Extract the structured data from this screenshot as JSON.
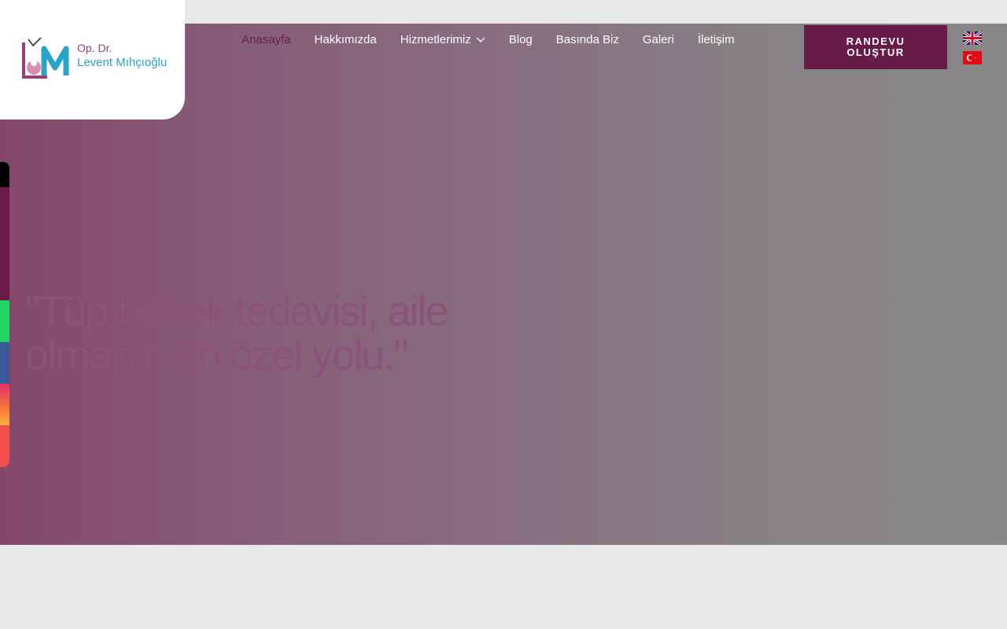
{
  "brand": {
    "logo_line1": "Op. Dr.",
    "logo_line2": "Levent Mıhçıoğlu",
    "colors": {
      "primary": "#671c47",
      "accent": "#2aa3c9",
      "mono_pink": "#c76b9a"
    }
  },
  "nav": {
    "items": [
      {
        "label": "Anasayfa"
      },
      {
        "label": "Hakkımızda"
      },
      {
        "label": "Hizmetlerimiz"
      },
      {
        "label": "Blog"
      },
      {
        "label": "Basında Biz"
      },
      {
        "label": "Galeri"
      },
      {
        "label": "İletişim"
      }
    ]
  },
  "cta": {
    "line1": "RANDEVU",
    "line2": "OLUŞTUR"
  },
  "languages": [
    {
      "icon": "flag-uk-icon"
    },
    {
      "icon": "flag-tr-icon"
    }
  ],
  "social": [
    {
      "icon": "x-twitter-icon",
      "color": "#000000"
    },
    {
      "icon": "plum-side-icon",
      "color": "#6b1b47"
    },
    {
      "icon": "whatsapp-icon",
      "color": "#25d366"
    },
    {
      "icon": "facebook-icon",
      "color": "#3b5998"
    },
    {
      "icon": "instagram-icon",
      "color": "#e1306c"
    },
    {
      "icon": "youtube-icon",
      "color": "#f24e4e"
    }
  ],
  "hero": {
    "quote": "\"Tüp bebek tedavisi, aile olmanın en özel yolu.\""
  }
}
